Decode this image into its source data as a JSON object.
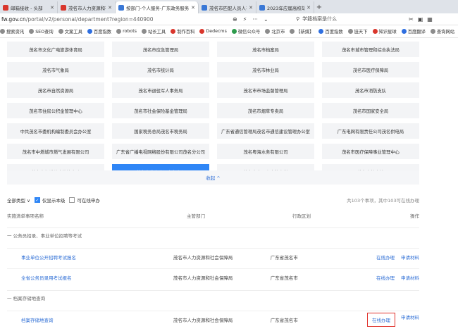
{
  "browser": {
    "tabs": [
      {
        "label": "邮箱接收 - 头部"
      },
      {
        "label": "茂名市人力资源和社会保障局"
      },
      {
        "label": "按部门-个人服务-广东政务服务",
        "active": true
      },
      {
        "label": "茂名市匹配人员人事档案业务"
      },
      {
        "label": "2023年应届高校毕业生档案转"
      }
    ],
    "url_host": "fw.gov.cn",
    "url_path": "/portal/v2/personal/department?region=440900",
    "search_placeholder": "学籍档案是什么",
    "bookmarks": [
      "搜索资讯",
      "SEO查询",
      "文案工具",
      "百度指数",
      "robots",
      "站长工具",
      "制作百科",
      "Dedecms",
      "微信公众号",
      "北京市",
      "【新媒】",
      "百度指数",
      "链天下",
      "知识星球",
      "百度翻译",
      "查询网站",
      "只要"
    ]
  },
  "departments": [
    "茂名市文化广电旅游体育局",
    "茂名市应急管理局",
    "茂名市档案局",
    "茂名市城市管理和综合执法局",
    "茂名市气象局",
    "茂名市统计局",
    "茂名市林业局",
    "茂名市医疗保障局",
    "茂名市自然资源局",
    "茂名市退役军人事务局",
    "茂名市市场监督管理局",
    "茂名市消防支队",
    "茂名市住房公积金管理中心",
    "茂名市社会保险基金管理局",
    "茂名市烟草专卖局",
    "茂名市国家安全局",
    "中共茂名市委机构编制委员会办公室",
    "国家税务总局茂名市税务局",
    "广东省通信管理局茂名市通信建设管理办公室",
    "广东电网有限责任公司茂名供电局",
    "茂名市中燃城市燃气发展有限公司",
    "广东省广播电视网络股份有限公司茂名分公司",
    "茂名粤海水务有限公司",
    "茂名市医疗保障事业管理中心",
    "茂名市海洋综合执法支队",
    "茂名市住房建设事务中心",
    "茂名市房屋安全鉴定所",
    "茂名市档案馆"
  ],
  "active_department_index": 25,
  "collapse_label": "收起 ^",
  "filters": {
    "all_types": "全部类型 ∨",
    "only_this_level": "仅显示本级",
    "online_only": "可在线申办",
    "count_text": "共103个事项，其中103可在线办理"
  },
  "table": {
    "headers": [
      "实施清单事项名称",
      "主管部门",
      "行政区划",
      "操作"
    ],
    "groups": [
      {
        "title": "一  公务员招录、事业单位招聘等考试",
        "rows": [
          {
            "name": "事业单位公开招聘考试报名",
            "dept": "茂名市人力资源和社会保障局",
            "region": "广东省茂名市",
            "op1": "在线办理",
            "op2": "申请材料"
          },
          {
            "name": "全省公务员录用考试报名",
            "dept": "茂名市人力资源和社会保障局",
            "region": "广东省茂名市",
            "op1": "在线办理",
            "op2": "申请材料"
          }
        ]
      },
      {
        "title": "一  档案存储地查询",
        "rows": [
          {
            "name": "档案存储地查询",
            "dept": "茂名市人力资源和社会保障局",
            "region": "广东省茂名市",
            "op1": "在线办理",
            "op2": "申请材料"
          }
        ]
      }
    ]
  }
}
